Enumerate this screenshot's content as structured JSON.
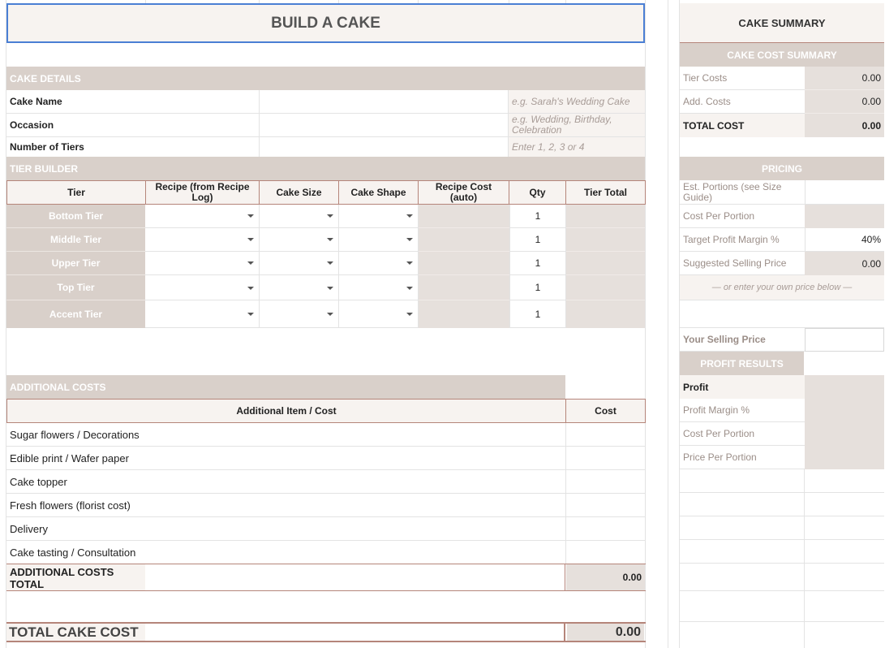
{
  "title": "BUILD A CAKE",
  "cake_details": {
    "section": "CAKE DETAILS",
    "rows": [
      {
        "label": "Cake Name",
        "hint": "e.g. Sarah's Wedding Cake"
      },
      {
        "label": "Occasion",
        "hint": "e.g. Wedding, Birthday, Celebration"
      },
      {
        "label": "Number of Tiers",
        "hint": "Enter 1, 2, 3 or 4"
      }
    ]
  },
  "tier_builder": {
    "section": "TIER BUILDER",
    "headers": [
      "Tier",
      "Recipe (from Recipe Log)",
      "Cake Size",
      "Cake Shape",
      "Recipe Cost (auto)",
      "Qty",
      "Tier Total"
    ],
    "rows": [
      {
        "tier": "Bottom Tier",
        "qty": "1"
      },
      {
        "tier": "Middle Tier",
        "qty": "1"
      },
      {
        "tier": "Upper Tier",
        "qty": "1"
      },
      {
        "tier": "Top Tier",
        "qty": "1"
      },
      {
        "tier": "Accent Tier",
        "qty": "1"
      }
    ]
  },
  "additional_costs": {
    "section": "ADDITIONAL COSTS",
    "header_item": "Additional Item / Cost",
    "header_cost": "Cost",
    "items": [
      "Sugar flowers / Decorations",
      "Edible print / Wafer paper",
      "Cake topper",
      "Fresh flowers (florist cost)",
      "Delivery",
      "Cake tasting / Consultation"
    ],
    "total_label": "ADDITIONAL COSTS TOTAL",
    "total_value": "0.00"
  },
  "total_cake_cost": {
    "label": "TOTAL CAKE COST",
    "value": "0.00"
  },
  "summary": {
    "title": "CAKE SUMMARY",
    "cost_section": "CAKE COST SUMMARY",
    "tier_costs": {
      "label": "Tier Costs",
      "value": "0.00"
    },
    "add_costs": {
      "label": "Add. Costs",
      "value": "0.00"
    },
    "total_cost": {
      "label": "TOTAL COST",
      "value": "0.00"
    },
    "pricing_section": "PRICING",
    "est_portions": {
      "label": "Est. Portions (see Size Guide)"
    },
    "cost_per_portion": {
      "label": "Cost Per Portion"
    },
    "target_margin": {
      "label": "Target Profit Margin %",
      "value": "40%"
    },
    "suggested_price": {
      "label": "Suggested Selling Price",
      "value": "0.00"
    },
    "own_price_note": "— or enter your own price below —",
    "selling_price": {
      "label": "Your Selling Price"
    },
    "profit_section": "PROFIT RESULTS",
    "profit": {
      "label": "Profit"
    },
    "profit_margin": {
      "label": "Profit Margin %"
    },
    "result_cost_per_portion": {
      "label": "Cost Per Portion"
    },
    "price_per_portion": {
      "label": "Price Per Portion"
    }
  }
}
